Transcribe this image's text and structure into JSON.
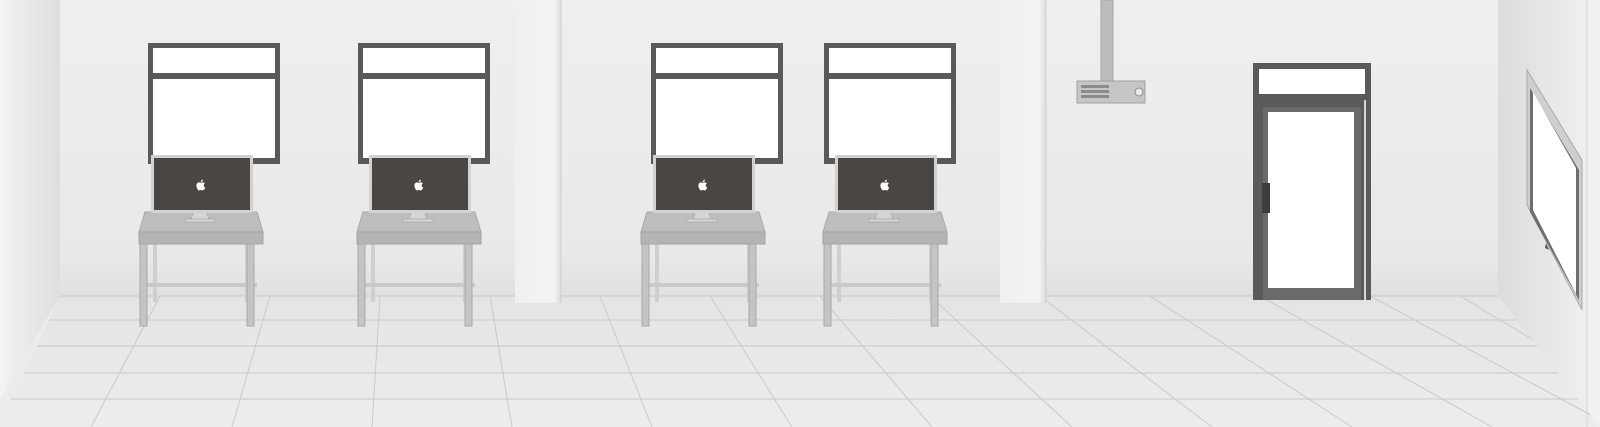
{
  "scene": {
    "colors": {
      "wall": "#ebebeb",
      "wall_shadow": "#d9d9d9",
      "floor": "#e6e6e6",
      "floor_grid": "#c9c9c9",
      "pillar": "#f1f1f1",
      "window_frame": "#595959",
      "window_glass": "#ffffff",
      "monitor_screen": "#4a4644",
      "monitor_bezel": "#d2d2d2",
      "desk_top": "#bdbdbd",
      "desk_leg": "#c4c4c4",
      "projector": "#bfbfbf",
      "door_frame": "#5a5a5a",
      "whiteboard_frame": "#c8c8c8"
    },
    "icons": {
      "computer_logo": "apple-logo-icon"
    },
    "stations_count": 4,
    "windows_count": 4
  }
}
